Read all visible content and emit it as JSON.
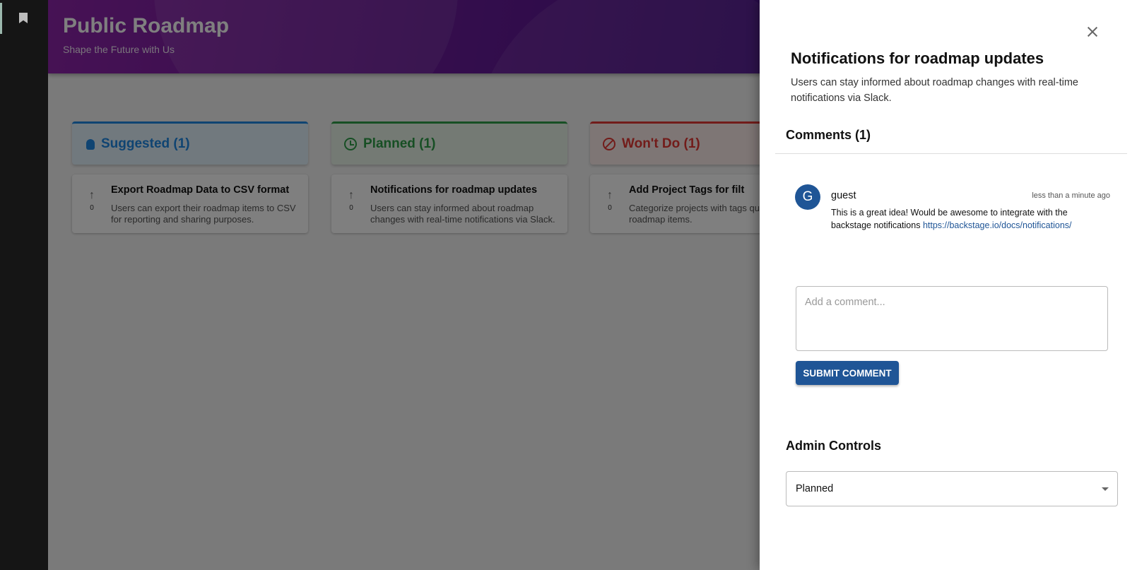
{
  "app": {
    "title": "Public Roadmap",
    "subtitle": "Shape the Future with Us"
  },
  "sidebar": {
    "icons": [
      "bookmark-icon"
    ]
  },
  "columns": [
    {
      "label": "Suggested (1)",
      "color": "#1e88e5",
      "icon": "lightbulb-icon",
      "card": {
        "title": "Export Roadmap Data to CSV format",
        "description": "Users can export their roadmap items to CSV for reporting and sharing purposes.",
        "votes": "0"
      }
    },
    {
      "label": "Planned (1)",
      "color": "#2e9e49",
      "icon": "clock-icon",
      "card": {
        "title": "Notifications for roadmap updates",
        "description": "Users can stay informed about roadmap changes with real-time notifications via Slack.",
        "votes": "0"
      }
    },
    {
      "label": "Won't Do (1)",
      "color": "#e53935",
      "icon": "block-icon",
      "card": {
        "title": "Add Project Tags for filt",
        "description": "Categorize projects with tags quickly filter roadmap items.",
        "votes": "0"
      }
    }
  ],
  "drawer": {
    "title": "Notifications for roadmap updates",
    "description": "Users can stay informed about roadmap changes with real-time notifications via Slack.",
    "comments_heading": "Comments (1)",
    "comments": [
      {
        "avatar_letter": "G",
        "user": "guest",
        "time": "less than a minute ago",
        "text": "This is a great idea! Would be awesome to integrate with the backstage notifications ",
        "link": "https://backstage.io/docs/notifications/"
      }
    ],
    "comment_placeholder": "Add a comment...",
    "submit_label": "SUBMIT COMMENT",
    "admin_heading": "Admin Controls",
    "status_value": "Planned"
  }
}
